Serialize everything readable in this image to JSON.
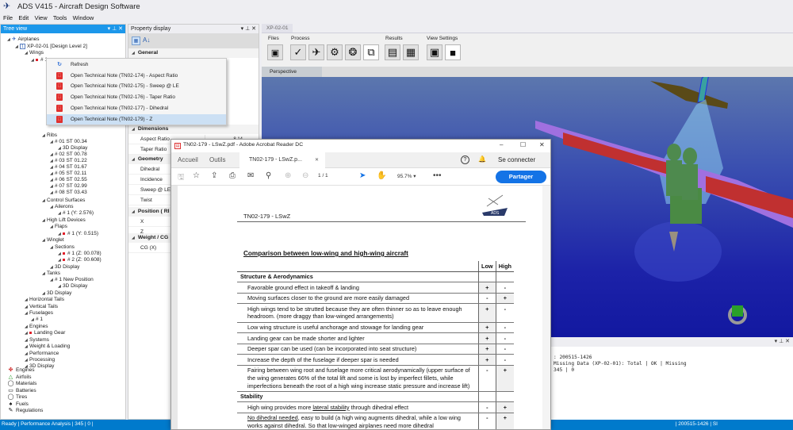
{
  "app": {
    "title": "ADS V415 - Aircraft Design Software",
    "menu": [
      "File",
      "Edit",
      "View",
      "Tools",
      "Window"
    ]
  },
  "tree_view": {
    "title": "Tree view",
    "controls": "▾ ⊥ ✕",
    "nodes": [
      {
        "label": "Airplanes",
        "level": 0,
        "icon": "airplane-icon"
      },
      {
        "label": "XP-02-01 [Design Level 2]",
        "level": 1,
        "icon": "design-doc-icon"
      },
      {
        "label": "Wings",
        "level": 2
      },
      {
        "label": "# 1",
        "level": 3,
        "flag": "red"
      },
      {
        "label": "Ribs",
        "level": 4
      },
      {
        "label": "# 01 ST 00.34",
        "level": 5
      },
      {
        "label": "3D Display",
        "level": 6
      },
      {
        "label": "# 02 ST 00.78",
        "level": 5
      },
      {
        "label": "# 03 ST 01.22",
        "level": 5
      },
      {
        "label": "# 04 ST 01.67",
        "level": 5
      },
      {
        "label": "# 05 ST 02.11",
        "level": 5
      },
      {
        "label": "# 06 ST 02.55",
        "level": 5
      },
      {
        "label": "# 07 ST 02.99",
        "level": 5
      },
      {
        "label": "# 08 ST 03.43",
        "level": 5
      },
      {
        "label": "Control Surfaces",
        "level": 4
      },
      {
        "label": "Ailerons",
        "level": 5
      },
      {
        "label": "# 1 (Y: 2.576)",
        "level": 6
      },
      {
        "label": "High Lift Devices",
        "level": 4
      },
      {
        "label": "Flaps",
        "level": 5
      },
      {
        "label": "# 1 (Y: 0.515)",
        "level": 6,
        "flag": "red"
      },
      {
        "label": "Winglet",
        "level": 4
      },
      {
        "label": "Sections",
        "level": 5
      },
      {
        "label": "# 1 (Z: 00.078)",
        "level": 6,
        "flag": "red"
      },
      {
        "label": "# 2 (Z: 00.608)",
        "level": 6,
        "flag": "red"
      },
      {
        "label": "3D Display",
        "level": 5
      },
      {
        "label": "Tanks",
        "level": 4
      },
      {
        "label": "# 1 New Position",
        "level": 5
      },
      {
        "label": "3D Display",
        "level": 6
      },
      {
        "label": "3D Display",
        "level": 4
      },
      {
        "label": "Horizontal Tails",
        "level": 2
      },
      {
        "label": "Vertical Tails",
        "level": 2
      },
      {
        "label": "Fuselages",
        "level": 2
      },
      {
        "label": "# 1",
        "level": 3
      },
      {
        "label": "Engines",
        "level": 2
      },
      {
        "label": "Landing Gear",
        "level": 2,
        "flag": "red"
      },
      {
        "label": "Systems",
        "level": 2
      },
      {
        "label": "Weight & Loading",
        "level": 2
      },
      {
        "label": "Performance",
        "level": 2
      },
      {
        "label": "Processing",
        "level": 2
      },
      {
        "label": "3D Display",
        "level": 2
      }
    ],
    "libraries": [
      {
        "label": "Engines",
        "icon": "engine-icon"
      },
      {
        "label": "Airfoils",
        "icon": "airfoil-icon"
      },
      {
        "label": "Materials",
        "icon": "materials-icon"
      },
      {
        "label": "Batteries",
        "icon": "battery-icon"
      },
      {
        "label": "Tires",
        "icon": "tire-icon"
      },
      {
        "label": "Fuels",
        "icon": "fuel-icon"
      },
      {
        "label": "Regulations",
        "icon": "regulations-icon"
      }
    ]
  },
  "context_menu": {
    "items": [
      {
        "label": "Refresh",
        "icon": "refresh-icon"
      },
      {
        "label": "Open Technical Note (TN02-174) - Aspect Ratio",
        "icon": "pdf-icon"
      },
      {
        "label": "Open Technical Note (TN02-175) - Sweep @ LE",
        "icon": "pdf-icon"
      },
      {
        "label": "Open Technical Note (TN02-176) - Taper Ratio",
        "icon": "pdf-icon"
      },
      {
        "label": "Open Technical Note (TN02-177) - Dihedral",
        "icon": "pdf-icon"
      },
      {
        "label": "Open Technical Note (TN02-179) - Z",
        "icon": "pdf-icon",
        "selected": true
      }
    ]
  },
  "property_display": {
    "title": "Property display",
    "controls": "▾ ⊥ ✕",
    "categories": [
      {
        "name": "General",
        "rows": []
      },
      {
        "name": "Dimensions",
        "rows": [
          {
            "label": "Aspect Ratio",
            "value": "8.14"
          },
          {
            "label": "Taper Ratio",
            "value": ""
          }
        ]
      },
      {
        "name": "Geometry",
        "rows": [
          {
            "label": "Dihedral",
            "value": ""
          },
          {
            "label": "Incidence",
            "value": ""
          },
          {
            "label": "Sweep @ LE",
            "value": ""
          },
          {
            "label": "Twist",
            "value": ""
          }
        ]
      },
      {
        "name": "Position ( RI )",
        "rows": [
          {
            "label": "X",
            "value": ""
          },
          {
            "label": "Z",
            "value": ""
          }
        ]
      },
      {
        "name": "Weight / CG",
        "rows": [
          {
            "label": "CG (X)",
            "value": ""
          }
        ]
      }
    ]
  },
  "design": {
    "doc_tab": "XP-02-01",
    "ribbon": {
      "groups": [
        "Files",
        "Process",
        "Results",
        "View Settings"
      ],
      "buttons": [
        {
          "name": "save",
          "glyph": "💾"
        },
        {
          "name": "check",
          "glyph": "✓"
        },
        {
          "name": "airplane",
          "glyph": "✈"
        },
        {
          "name": "gear",
          "glyph": "⚙"
        },
        {
          "name": "mesh",
          "glyph": "❂"
        },
        {
          "name": "resize",
          "glyph": "⧉"
        },
        {
          "name": "report",
          "glyph": "▤"
        },
        {
          "name": "grid",
          "glyph": "▦"
        },
        {
          "name": "wireframe",
          "glyph": "▣"
        },
        {
          "name": "solid",
          "glyph": "■"
        }
      ]
    },
    "view_tab": "Perspective"
  },
  "output": {
    "controls": "▾ ⊥ ✕",
    "lines": [
      ": 200515-1426",
      "Missing Data (XP-02-01): Total | OK | Missing",
      "345 | 0"
    ]
  },
  "status": {
    "left": "Ready | Performance Analysis | 345 | 0 |",
    "right": "| 200515-1426 | SI"
  },
  "acrobat": {
    "title": "TN02-179 - LSwZ.pdf - Adobe Acrobat Reader DC",
    "nav": [
      "Accueil",
      "Outils"
    ],
    "doc_tab": "TN02-179 - LSwZ.p...",
    "sign_in": "Se connecter",
    "page": "1",
    "page_total": "/ 1",
    "zoom": "95.7%",
    "share": "Partager",
    "document": {
      "header": "TN02-179 - LSwZ",
      "logo_text": "ADS",
      "title": "Comparison between low-wing and high-wing aircraft",
      "columns": [
        "Low",
        "High"
      ],
      "rows": [
        {
          "type": "section",
          "text": "Structure & Aerodynamics"
        },
        {
          "type": "item",
          "text": "Favorable ground effect in takeoff & landing",
          "low": "+",
          "high": "-"
        },
        {
          "type": "item",
          "text": "Moving surfaces closer to the ground are more easily damaged",
          "low": "-",
          "high": "+"
        },
        {
          "type": "item",
          "text": "High wings tend to be strutted because they are often thinner so as to leave enough headroom. (more draggy than low-winged arrangements)",
          "low": "+",
          "high": "-"
        },
        {
          "type": "item",
          "text": "Low wing structure is useful anchorage and stowage for landing gear",
          "low": "+",
          "high": "-"
        },
        {
          "type": "item",
          "text": "Landing gear can be made shorter and lighter",
          "low": "+",
          "high": "-"
        },
        {
          "type": "item",
          "text": "Deeper spar can be used (can be incorporated into seat structure)",
          "low": "+",
          "high": "-"
        },
        {
          "type": "item",
          "text": "Increase the depth of the fuselage if deeper spar is needed",
          "low": "+",
          "high": "-"
        },
        {
          "type": "item",
          "text": "Fairing between wing root and fuselage more critical aerodynamically (upper surface of the wing generates 66% of the total lift and some is lost by imperfect fillets, while imperfections beneath the root of a high wing increase static pressure and increase lift)",
          "low": "-",
          "high": "+"
        },
        {
          "type": "section",
          "text": "Stability"
        },
        {
          "type": "item",
          "text_pre": "High wing provides more ",
          "text_ul": "lateral stability",
          "text_post": " through dihedral effect",
          "low": "-",
          "high": "+"
        },
        {
          "type": "item",
          "text_ul": "No dihedral needed",
          "text_post": ", easy to build (a high wing augments dihedral, while a low wing works against dihedral. So that low-winged airplanes need more dihedral",
          "low": "-",
          "high": "+"
        }
      ]
    }
  }
}
